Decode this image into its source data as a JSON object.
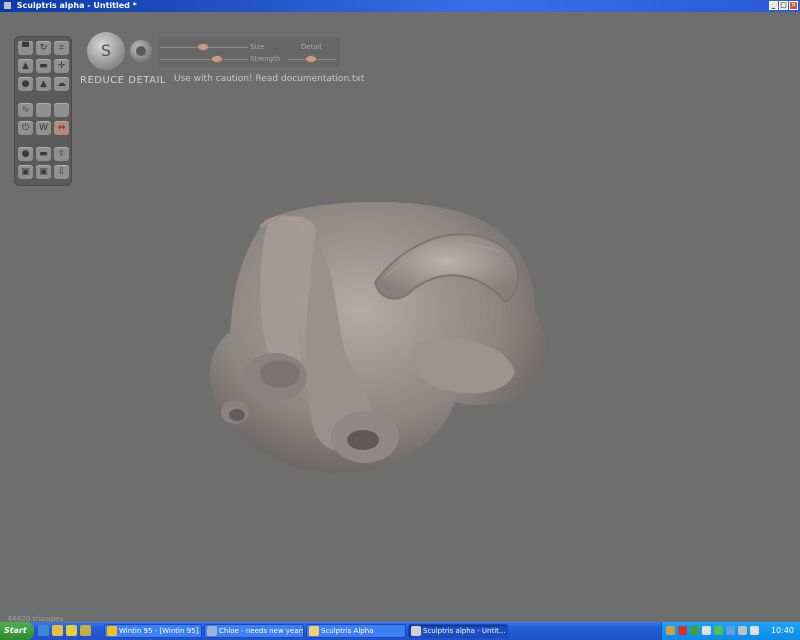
{
  "window": {
    "title": "Sculptris alpha - Untitled *",
    "minimize": "_",
    "maximize": "□",
    "close": "✕"
  },
  "toolbar": {
    "brush_glyph": "S",
    "tool_name": "REDUCE DETAIL",
    "caution": "Use with caution! Read documentation.txt",
    "size_label": "Size",
    "detail_label": "Detail",
    "strength_label": "Strength"
  },
  "tools": [
    {
      "name": "draw-tool",
      "glyph": "▀"
    },
    {
      "name": "rotate-tool",
      "glyph": "↻"
    },
    {
      "name": "crop-tool",
      "glyph": "⌗"
    },
    {
      "name": "inflate-tool",
      "glyph": "▲"
    },
    {
      "name": "flatten-tool",
      "glyph": "▬"
    },
    {
      "name": "pinch-tool",
      "glyph": "✛"
    },
    {
      "name": "figure-tool",
      "glyph": "●"
    },
    {
      "name": "mound-tool",
      "glyph": "▲"
    },
    {
      "name": "cloud-tool",
      "glyph": "☁"
    },
    {
      "name": "reduce-detail-tool",
      "glyph": "∿"
    },
    {
      "name": "blank-tool-a",
      "glyph": ""
    },
    {
      "name": "blank-tool-b",
      "glyph": ""
    },
    {
      "name": "power-tool",
      "glyph": "⏻"
    },
    {
      "name": "wave-tool",
      "glyph": "W"
    },
    {
      "name": "symmetry-tool",
      "glyph": "⇔",
      "active": true
    },
    {
      "name": "sphere-tool",
      "glyph": "●"
    },
    {
      "name": "plane-tool",
      "glyph": "▬"
    },
    {
      "name": "export-tool",
      "glyph": "⇪"
    },
    {
      "name": "save-tool",
      "glyph": "▣"
    },
    {
      "name": "open-tool",
      "glyph": "▣"
    },
    {
      "name": "load-tool",
      "glyph": "⇩"
    }
  ],
  "status": {
    "triangles": "66820 triangles"
  },
  "taskbar": {
    "start": "Start",
    "tasks": [
      {
        "label": "Wintin 95 - [Wintin 95]",
        "color": "#f0c020"
      },
      {
        "label": "Chloe - needs new years...",
        "color": "#9ab4d8"
      },
      {
        "label": "Sculptris Alpha",
        "color": "#f0d070"
      },
      {
        "label": "Sculptris alpha - Untit...",
        "color": "#d0d0d0",
        "active": true
      }
    ],
    "clock": "10:40"
  }
}
